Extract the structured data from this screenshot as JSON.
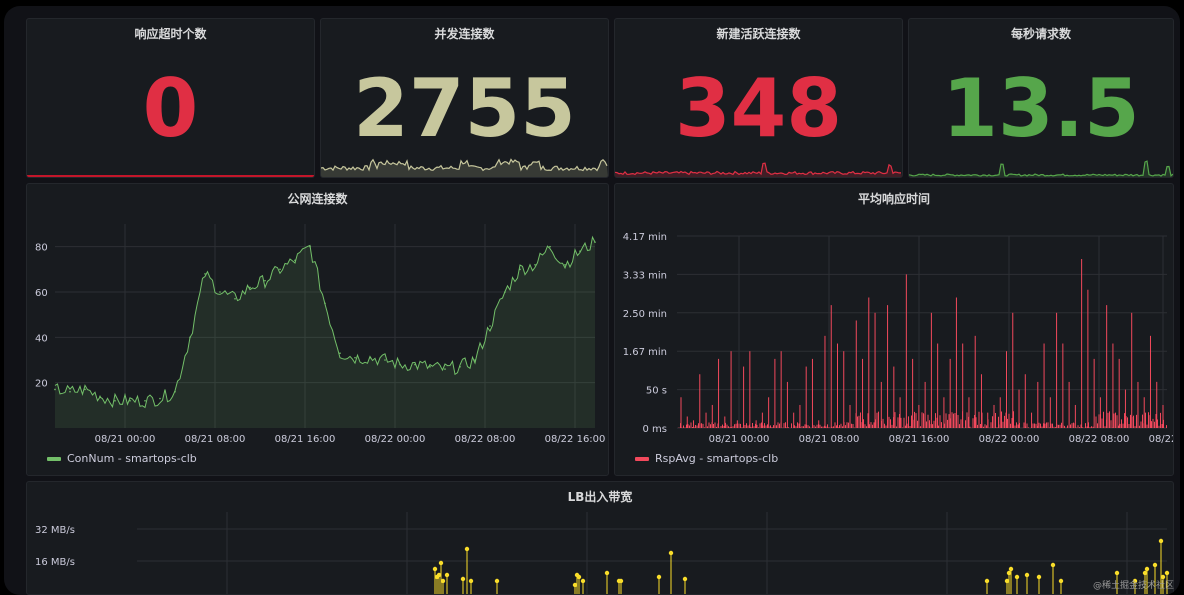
{
  "stats": [
    {
      "title": "响应超时个数",
      "value": "0",
      "color": "#e02f44"
    },
    {
      "title": "并发连接数",
      "value": "2755",
      "color": "#c7c79d"
    },
    {
      "title": "新建活跃连接数",
      "value": "348",
      "color": "#e02f44"
    },
    {
      "title": "每秒请求数",
      "value": "13.5",
      "color": "#56a64b"
    }
  ],
  "panels": {
    "public_conn": {
      "title": "公网连接数",
      "legend": "ConNum - smartops-clb",
      "color": "#73bf69"
    },
    "avg_rsp": {
      "title": "平均响应时间",
      "legend": "RspAvg - smartops-clb",
      "color": "#f2495c"
    },
    "lb_bw": {
      "title": "LB出入带宽",
      "color": "#fade2a"
    }
  },
  "watermark": "@稀土掘金技术社区",
  "chart_data": [
    {
      "type": "line",
      "title": "公网连接数",
      "xlabel": "",
      "ylabel": "",
      "x_ticks": [
        "08/21 00:00",
        "08/21 08:00",
        "08/21 16:00",
        "08/22 00:00",
        "08/22 08:00",
        "08/22 16:00"
      ],
      "y_ticks": [
        "20",
        "40",
        "60",
        "80"
      ],
      "ylim": [
        0,
        90
      ],
      "x": [
        "08/20 18:00",
        "08/20 20:00",
        "08/20 22:00",
        "08/21 00:00",
        "08/21 02:00",
        "08/21 04:00",
        "08/21 06:00",
        "08/21 07:00",
        "08/21 08:00",
        "08/21 09:00",
        "08/21 10:00",
        "08/21 11:00",
        "08/21 12:00",
        "08/21 13:00",
        "08/21 14:00",
        "08/21 15:00",
        "08/21 16:00",
        "08/21 17:00",
        "08/21 18:00",
        "08/21 19:00",
        "08/21 20:00",
        "08/21 22:00",
        "08/22 00:00",
        "08/22 02:00",
        "08/22 04:00",
        "08/22 06:00",
        "08/22 07:00",
        "08/22 08:00",
        "08/22 09:00",
        "08/22 10:00",
        "08/22 11:00",
        "08/22 12:00",
        "08/22 13:00",
        "08/22 14:00",
        "08/22 15:00",
        "08/22 16:00",
        "08/22 17:00"
      ],
      "series": [
        {
          "name": "ConNum - smartops-clb",
          "values": [
            17,
            16,
            17,
            14,
            12,
            12,
            12,
            13,
            16,
            40,
            68,
            60,
            57,
            62,
            65,
            70,
            74,
            80,
            55,
            33,
            31,
            31,
            30,
            28,
            28,
            27,
            26,
            27,
            30,
            45,
            60,
            70,
            72,
            80,
            72,
            78,
            82
          ]
        }
      ],
      "legend": "bottom-left",
      "grid": true
    },
    {
      "type": "bar",
      "title": "平均响应时间",
      "xlabel": "",
      "ylabel": "",
      "x_ticks": [
        "08/21 00:00",
        "08/21 08:00",
        "08/21 16:00",
        "08/22 00:00",
        "08/22 08:00",
        "08/22 16:00"
      ],
      "y_ticks": [
        "0 ms",
        "50 s",
        "1.67 min",
        "2.50 min",
        "3.33 min",
        "4.17 min"
      ],
      "ylim": [
        0,
        250
      ],
      "y_unit": "seconds",
      "series": [
        {
          "name": "RspAvg - smartops-clb",
          "values": [
            40,
            15,
            10,
            70,
            20,
            30,
            90,
            15,
            100,
            10,
            80,
            100,
            10,
            20,
            40,
            90,
            100,
            60,
            20,
            30,
            80,
            90,
            10,
            120,
            160,
            110,
            100,
            30,
            140,
            90,
            170,
            150,
            60,
            160,
            80,
            40,
            200,
            90,
            30,
            60,
            150,
            110,
            40,
            90,
            170,
            110,
            40,
            120,
            70,
            20,
            30,
            40,
            100,
            150,
            50,
            70,
            20,
            60,
            110,
            40,
            150,
            110,
            60,
            30,
            220,
            180,
            90,
            40,
            160,
            110,
            90,
            50,
            150,
            60,
            40,
            120,
            60,
            30
          ]
        }
      ],
      "legend": "bottom-left",
      "grid": true
    },
    {
      "type": "scatter",
      "title": "LB出入带宽",
      "xlabel": "",
      "ylabel": "",
      "y_ticks": [
        "16 MB/s",
        "32 MB/s"
      ],
      "ylim": [
        0,
        40
      ],
      "y_unit": "MB/s",
      "series": [
        {
          "name": "",
          "values": [
            12,
            8,
            9,
            15,
            6,
            9,
            7,
            6,
            6,
            20,
            4,
            9,
            8,
            6,
            10,
            6,
            6,
            8,
            7,
            22,
            6,
            6,
            10,
            12,
            8,
            9,
            8,
            14,
            6,
            10,
            6,
            10,
            26,
            8,
            14,
            10,
            12
          ]
        }
      ],
      "grid": true
    }
  ]
}
